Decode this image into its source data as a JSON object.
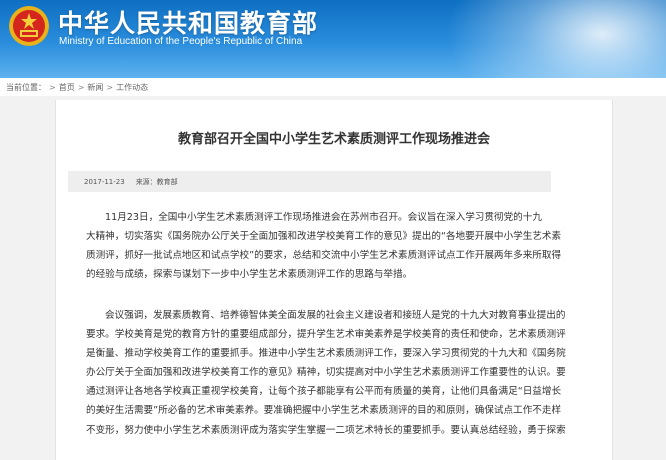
{
  "header": {
    "title": "中华人民共和国教育部",
    "subtitle": "Ministry of Education of the People's Republic of China"
  },
  "breadcrumb": {
    "label": "当前位置：",
    "items": [
      "首页",
      "新闻",
      "工作动态"
    ]
  },
  "article": {
    "title": "教育部召开全国中小学生艺术素质测评工作现场推进会",
    "date": "2017-11-23",
    "source": "来源：教育部",
    "paragraphs": [
      [
        "11月23日，全国中小学生艺术素质测评工作现场推进会在苏州市召开。会议旨在深入学习贯彻党的十九",
        "大精神，切实落实《国务院办公厅关于全面加强和改进学校美育工作的意见》提出的“各地要开展中小学生艺术素",
        "质测评，抓好一批试点地区和试点学校”的要求，总结和交流中小学生艺术素质测评试点工作开展两年多来所取得",
        "的经验与成绩，探索与谋划下一步中小学生艺术素质测评工作的思路与举措。"
      ],
      [
        "会议强调，发展素质教育、培养德智体美全面发展的社会主义建设者和接班人是党的十九大对教育事业提出的",
        "要求。学校美育是党的教育方针的重要组成部分，提升学生艺术审美素养是学校美育的责任和使命，艺术素质测评",
        "是衡量、推动学校美育工作的重要抓手。推进中小学生艺术素质测评工作，要深入学习贯彻党的十九大和《国务院",
        "办公厅关于全面加强和改进学校美育工作的意见》精神，切实提高对中小学生艺术素质测评工作重要性的认识。要",
        "通过测评让各地各学校真正重视学校美育，让每个孩子都能享有公平而有质量的美育，让他们具备满足“日益增长",
        "的美好生活需要”所必备的艺术审美素养。要准确把握中小学生艺术素质测评的目的和原则，确保试点工作不走样",
        "不变形，努力使中小学生艺术素质测评成为落实学生掌握一二项艺术特长的重要抓手。要认真总结经验，勇于探索"
      ]
    ]
  },
  "colors": {
    "banner_top": "#0e6fc2",
    "banner_bottom": "#5eb2ef",
    "page_bg": "#f2f2f2",
    "meta_bg": "#eeeeee",
    "text": "#333333"
  }
}
